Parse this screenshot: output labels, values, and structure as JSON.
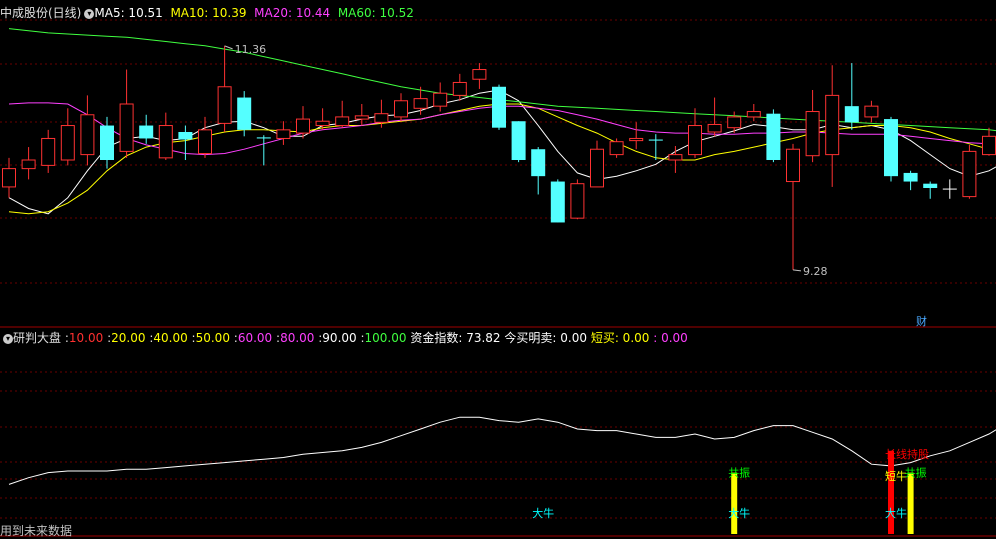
{
  "main_header": {
    "title": "中成股份(日线)",
    "ma": [
      {
        "label": "MA5: 10.51",
        "color": "#ffffff"
      },
      {
        "label": "MA10: 10.39",
        "color": "#ffff00"
      },
      {
        "label": "MA20: 10.44",
        "color": "#ff40ff"
      },
      {
        "label": "MA60: 10.52",
        "color": "#40ff40"
      }
    ]
  },
  "chart_data": [
    {
      "type": "candlestick",
      "title": "中成股份(日线)",
      "ylim": [
        9.0,
        11.6
      ],
      "high_label": "11.36",
      "low_label": "9.28",
      "event_label": "财",
      "candles": [
        [
          10.05,
          10.22,
          10.32,
          9.95
        ],
        [
          10.22,
          10.3,
          10.42,
          10.12
        ],
        [
          10.25,
          10.5,
          10.58,
          10.18
        ],
        [
          10.3,
          10.62,
          10.78,
          10.25
        ],
        [
          10.35,
          10.72,
          10.9,
          10.25
        ],
        [
          10.62,
          10.3,
          10.7,
          10.22
        ],
        [
          10.38,
          10.82,
          11.14,
          10.32
        ],
        [
          10.62,
          10.5,
          10.72,
          10.45
        ],
        [
          10.32,
          10.62,
          10.74,
          10.3
        ],
        [
          10.56,
          10.49,
          10.62,
          10.3
        ],
        [
          10.36,
          10.58,
          10.7,
          10.32
        ],
        [
          10.64,
          10.98,
          11.36,
          10.56
        ],
        [
          10.88,
          10.58,
          10.94,
          10.52
        ],
        [
          10.51,
          10.5,
          10.53,
          10.25
        ],
        [
          10.5,
          10.58,
          10.66,
          10.44
        ],
        [
          10.55,
          10.68,
          10.8,
          10.5
        ],
        [
          10.62,
          10.66,
          10.78,
          10.58
        ],
        [
          10.62,
          10.7,
          10.85,
          10.6
        ],
        [
          10.68,
          10.71,
          10.82,
          10.62
        ],
        [
          10.65,
          10.73,
          10.86,
          10.6
        ],
        [
          10.7,
          10.85,
          10.92,
          10.66
        ],
        [
          10.78,
          10.87,
          10.98,
          10.72
        ],
        [
          10.8,
          10.92,
          11.02,
          10.75
        ],
        [
          10.9,
          11.02,
          11.1,
          10.85
        ],
        [
          11.05,
          11.14,
          11.2,
          10.96
        ],
        [
          10.98,
          10.6,
          11.0,
          10.58
        ],
        [
          10.66,
          10.3,
          10.66,
          10.28
        ],
        [
          10.4,
          10.15,
          10.42,
          9.98
        ],
        [
          10.1,
          9.72,
          10.12,
          9.72
        ],
        [
          9.76,
          10.08,
          10.12,
          9.75
        ],
        [
          10.05,
          10.4,
          10.48,
          10.05
        ],
        [
          10.35,
          10.47,
          10.5,
          10.32
        ],
        [
          10.48,
          10.5,
          10.65,
          10.4
        ],
        [
          10.49,
          10.48,
          10.54,
          10.3
        ],
        [
          10.3,
          10.35,
          10.43,
          10.18
        ],
        [
          10.35,
          10.62,
          10.78,
          10.32
        ],
        [
          10.56,
          10.63,
          10.88,
          10.52
        ],
        [
          10.6,
          10.7,
          10.75,
          10.55
        ],
        [
          10.7,
          10.75,
          10.82,
          10.66
        ],
        [
          10.73,
          10.3,
          10.77,
          10.28
        ],
        [
          10.1,
          10.4,
          10.45,
          9.28
        ],
        [
          10.34,
          10.75,
          10.95,
          10.28
        ],
        [
          10.35,
          10.9,
          11.18,
          10.05
        ],
        [
          10.8,
          10.65,
          11.2,
          10.58
        ],
        [
          10.7,
          10.8,
          10.85,
          10.65
        ],
        [
          10.68,
          10.15,
          10.7,
          10.1
        ],
        [
          10.18,
          10.1,
          10.2,
          10.02
        ],
        [
          10.08,
          10.04,
          10.1,
          9.94
        ],
        [
          10.03,
          10.03,
          10.12,
          9.94
        ],
        [
          9.96,
          10.38,
          10.44,
          9.94
        ],
        [
          10.35,
          10.52,
          10.6,
          10.34
        ],
        [
          10.52,
          10.61,
          10.67,
          10.45
        ],
        [
          10.68,
          11.02,
          11.07,
          10.65
        ]
      ],
      "series": [
        {
          "name": "MA5",
          "color": "#ffffff",
          "values": [
            9.95,
            9.85,
            9.8,
            9.95,
            10.2,
            10.42,
            10.5,
            10.52,
            10.48,
            10.5,
            10.6,
            10.65,
            10.66,
            10.6,
            10.52,
            10.52,
            10.62,
            10.64,
            10.68,
            10.71,
            10.72,
            10.76,
            10.82,
            10.86,
            10.92,
            10.95,
            10.85,
            10.62,
            10.38,
            10.18,
            10.12,
            10.15,
            10.2,
            10.26,
            10.38,
            10.47,
            10.52,
            10.57,
            10.63,
            10.61,
            10.58,
            10.58,
            10.63,
            10.6,
            10.62,
            10.58,
            10.48,
            10.35,
            10.22,
            10.15,
            10.2,
            10.3,
            10.51
          ]
        },
        {
          "name": "MA10",
          "color": "#ffff00",
          "values": [
            9.82,
            9.8,
            9.82,
            9.9,
            10.02,
            10.2,
            10.34,
            10.42,
            10.46,
            10.48,
            10.52,
            10.56,
            10.58,
            10.58,
            10.57,
            10.56,
            10.6,
            10.62,
            10.62,
            10.64,
            10.66,
            10.68,
            10.72,
            10.76,
            10.8,
            10.82,
            10.82,
            10.78,
            10.7,
            10.62,
            10.55,
            10.46,
            10.38,
            10.32,
            10.3,
            10.3,
            10.35,
            10.38,
            10.42,
            10.46,
            10.5,
            10.55,
            10.58,
            10.6,
            10.62,
            10.62,
            10.6,
            10.56,
            10.5,
            10.45,
            10.4,
            10.38,
            10.39
          ]
        },
        {
          "name": "MA20",
          "color": "#ff40ff",
          "values": [
            10.82,
            10.83,
            10.83,
            10.82,
            10.72,
            10.6,
            10.5,
            10.44,
            10.4,
            10.36,
            10.35,
            10.36,
            10.4,
            10.45,
            10.5,
            10.55,
            10.58,
            10.6,
            10.62,
            10.65,
            10.67,
            10.68,
            10.72,
            10.75,
            10.78,
            10.8,
            10.8,
            10.78,
            10.76,
            10.72,
            10.68,
            10.63,
            10.58,
            10.56,
            10.55,
            10.55,
            10.54,
            10.54,
            10.55,
            10.55,
            10.56,
            10.56,
            10.55,
            10.54,
            10.54,
            10.54,
            10.52,
            10.5,
            10.48,
            10.46,
            10.45,
            10.44,
            10.44
          ]
        },
        {
          "name": "MA60",
          "color": "#40ff40",
          "values": [
            11.52,
            11.5,
            11.48,
            11.47,
            11.46,
            11.45,
            11.44,
            11.42,
            11.4,
            11.38,
            11.36,
            11.33,
            11.3,
            11.26,
            11.22,
            11.18,
            11.14,
            11.1,
            11.06,
            11.02,
            10.98,
            10.95,
            10.92,
            10.9,
            10.88,
            10.86,
            10.84,
            10.82,
            10.8,
            10.79,
            10.78,
            10.77,
            10.76,
            10.75,
            10.74,
            10.73,
            10.72,
            10.71,
            10.7,
            10.69,
            10.68,
            10.67,
            10.66,
            10.65,
            10.64,
            10.63,
            10.62,
            10.61,
            10.6,
            10.59,
            10.58,
            10.56,
            10.52
          ]
        }
      ]
    },
    {
      "type": "line",
      "title": "研判大盘",
      "ylim": [
        0,
        100
      ],
      "series": [
        {
          "name": "资金指数",
          "color": "#ffffff",
          "values": [
            20,
            24,
            27,
            28,
            28,
            28,
            29,
            29,
            30,
            31,
            32,
            33,
            34,
            35,
            36,
            38,
            39,
            40,
            42,
            45,
            49,
            53,
            57,
            60,
            60,
            58,
            57,
            59,
            57,
            53,
            52,
            52,
            50,
            48,
            48,
            50,
            47,
            48,
            52,
            55,
            55,
            51,
            47,
            40,
            32,
            31,
            33,
            37,
            40,
            45,
            50,
            57,
            71
          ]
        }
      ],
      "histogram": [
        {
          "index": 37,
          "color": "#ffff00",
          "value": 27
        },
        {
          "index": 45,
          "color": "#ff0000",
          "value": 40
        },
        {
          "index": 46,
          "color": "#ffff00",
          "value": 27
        }
      ],
      "annotations": [
        {
          "text": "大牛",
          "index": 27,
          "color": "#00ffff",
          "value": 3
        },
        {
          "text": "共振",
          "index": 37,
          "color": "#00ff00",
          "value": 27
        },
        {
          "text": "大牛",
          "index": 37,
          "color": "#00ffff",
          "value": 3
        },
        {
          "text": "长线持股",
          "index": 45,
          "color": "#ff0000",
          "value": 38
        },
        {
          "text": "短牛",
          "index": 45,
          "color": "#ffff00",
          "value": 25
        },
        {
          "text": "共振",
          "index": 46,
          "color": "#00ff00",
          "value": 27
        },
        {
          "text": "大牛",
          "index": 45,
          "color": "#00ffff",
          "value": 3
        }
      ]
    }
  ],
  "sub_header": {
    "title": "研判大盘",
    "levels": [
      {
        "label": "10.00",
        "color": "#ff3030"
      },
      {
        "label": "20.00",
        "color": "#ffff00"
      },
      {
        "label": "40.00",
        "color": "#ffff00"
      },
      {
        "label": "50.00",
        "color": "#ffff00"
      },
      {
        "label": "60.00",
        "color": "#ff40ff"
      },
      {
        "label": "80.00",
        "color": "#ff40ff"
      },
      {
        "label": "90.00",
        "color": "#ffffff"
      },
      {
        "label": "100.00",
        "color": "#40ff40"
      }
    ],
    "fund_index": "资金指数: 73.82",
    "clear_buy_sell": "今买明卖: 0.00",
    "short_buy_label": "短买",
    "short_buy_value": ": 0.00",
    "last_value": ": 0.00"
  },
  "footer": {
    "text": "用到未来数据"
  }
}
